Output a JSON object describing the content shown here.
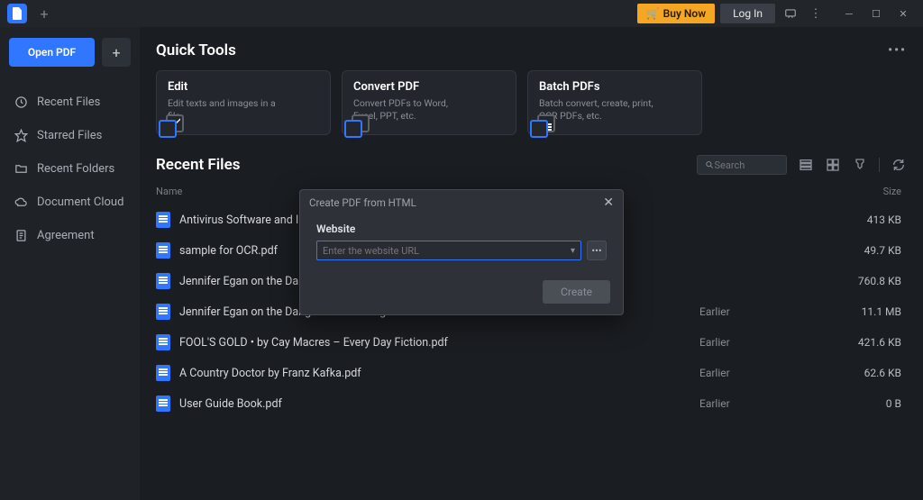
{
  "titlebar": {
    "new_tab": "+",
    "buy": "Buy Now",
    "login": "Log In"
  },
  "sidebar": {
    "open_pdf": "Open PDF",
    "plus": "+",
    "items": [
      {
        "label": "Recent Files"
      },
      {
        "label": "Starred Files"
      },
      {
        "label": "Recent Folders"
      },
      {
        "label": "Document Cloud"
      },
      {
        "label": "Agreement"
      }
    ]
  },
  "quicktools": {
    "title": "Quick Tools",
    "more": "•••",
    "cards": [
      {
        "title": "Edit",
        "desc": "Edit texts and images in a file."
      },
      {
        "title": "Convert PDF",
        "desc": "Convert PDFs to Word, Excel, PPT, etc."
      },
      {
        "title": "Batch PDFs",
        "desc": "Batch convert, create, print, OCR PDFs, etc."
      }
    ]
  },
  "recent": {
    "title": "Recent Files",
    "search_placeholder": "Search",
    "col_name": "Name",
    "col_mod": "",
    "col_size": "Size",
    "files": [
      {
        "name": "Antivirus Software and Internet…",
        "mod": "",
        "size": "413 KB"
      },
      {
        "name": "sample for OCR.pdf",
        "mod": "",
        "size": "49.7 KB"
      },
      {
        "name": "Jennifer Egan on the Dangers o…",
        "mod": "",
        "size": "760.8 KB"
      },
      {
        "name": "Jennifer Egan on the Dangers of Knowing – The New Yorker - …",
        "mod": "Earlier",
        "size": "11.1 MB"
      },
      {
        "name": "FOOL'S GOLD • by Cay Macres – Every Day Fiction.pdf",
        "mod": "Earlier",
        "size": "421.6 KB"
      },
      {
        "name": "A Country Doctor by Franz Kafka.pdf",
        "mod": "Earlier",
        "size": "62.6 KB"
      },
      {
        "name": "User Guide Book.pdf",
        "mod": "Earlier",
        "size": "0 B"
      }
    ]
  },
  "dialog": {
    "title": "Create PDF from HTML",
    "website_label": "Website",
    "url_placeholder": "Enter the website URL",
    "dots": "•••",
    "create": "Create",
    "close": "✕"
  }
}
